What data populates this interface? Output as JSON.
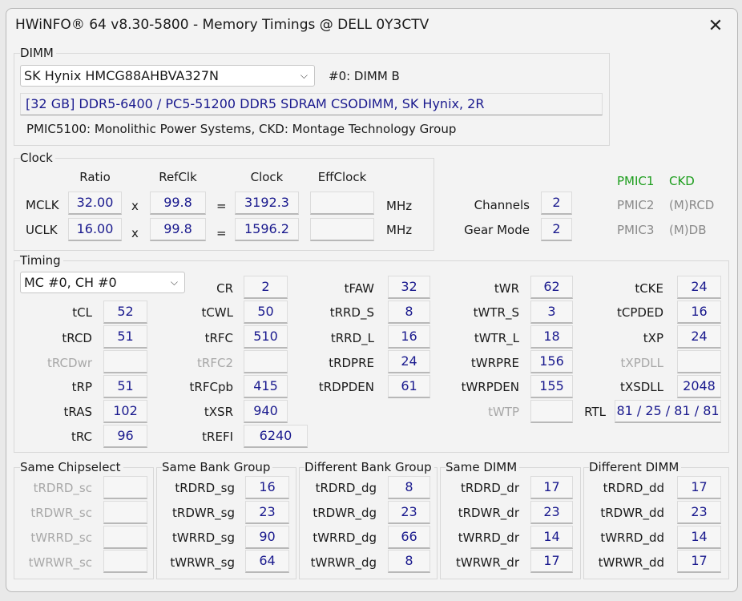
{
  "window": {
    "title": "HWiNFO® 64 v8.30-5800 - Memory Timings @ DELL 0Y3CTV",
    "close_glyph": "✕"
  },
  "dimm": {
    "label": "DIMM",
    "module": "SK Hynix HMCG88AHBVA327N",
    "slot": "#0: DIMM B",
    "description": "[32 GB] DDR5-6400 / PC5-51200 DDR5 SDRAM CSODIMM, SK Hynix, 2R",
    "pmic": "PMIC5100: Monolithic Power Systems, CKD: Montage Technology Group"
  },
  "clock": {
    "label": "Clock",
    "headers": {
      "ratio": "Ratio",
      "refclk": "RefClk",
      "clock": "Clock",
      "effclock": "EffClock"
    },
    "mult": "x",
    "eq": "=",
    "unit": "MHz",
    "mclk": {
      "name": "MCLK",
      "ratio": "32.00",
      "refclk": "99.8",
      "clock": "3192.3",
      "effclock": ""
    },
    "uclk": {
      "name": "UCLK",
      "ratio": "16.00",
      "refclk": "99.8",
      "clock": "1596.2",
      "effclock": ""
    },
    "channels_label": "Channels",
    "channels": "2",
    "gear_label": "Gear Mode",
    "gear": "2",
    "pmic1": "PMIC1",
    "ckd": "CKD",
    "pmic2": "PMIC2",
    "mrcd": "(M)RCD",
    "pmic3": "PMIC3",
    "mdb": "(M)DB"
  },
  "timing": {
    "label": "Timing",
    "channel": "MC #0, CH #0",
    "CR": "2",
    "tCL": "52",
    "tRCD": "51",
    "tRCDwr": "",
    "tRP": "51",
    "tRAS": "102",
    "tRC": "96",
    "tCWL": "50",
    "tRFC": "510",
    "tRFC2": "",
    "tRFCpb": "415",
    "tXSR": "940",
    "tREFI": "6240",
    "tFAW": "32",
    "tRRD_S": "8",
    "tRRD_L": "16",
    "tRDPRE": "24",
    "tRDPDEN": "61",
    "tWR": "62",
    "tWTR_S": "3",
    "tWTR_L": "18",
    "tWRPRE": "156",
    "tWRPDEN": "155",
    "tWTP": "",
    "tCKE": "24",
    "tCPDED": "16",
    "tXP": "24",
    "tXPDLL": "",
    "tXSDLL": "2048",
    "RTL": "81 / 25 / 81 / 81"
  },
  "same_chipselect": {
    "label": "Same Chipselect",
    "tRDRD_sc": "",
    "tRDWR_sc": "",
    "tWRRD_sc": "",
    "tWRWR_sc": ""
  },
  "same_bank_group": {
    "label": "Same Bank Group",
    "tRDRD_sg": "16",
    "tRDWR_sg": "23",
    "tWRRD_sg": "90",
    "tWRWR_sg": "64"
  },
  "diff_bank_group": {
    "label": "Different Bank Group",
    "tRDRD_dg": "8",
    "tRDWR_dg": "23",
    "tWRRD_dg": "66",
    "tWRWR_dg": "8"
  },
  "same_dimm": {
    "label": "Same DIMM",
    "tRDRD_dr": "17",
    "tRDWR_dr": "23",
    "tWRRD_dr": "14",
    "tWRWR_dr": "17"
  },
  "diff_dimm": {
    "label": "Different DIMM",
    "tRDRD_dd": "17",
    "tRDWR_dd": "23",
    "tWRRD_dd": "14",
    "tWRWR_dd": "17"
  }
}
